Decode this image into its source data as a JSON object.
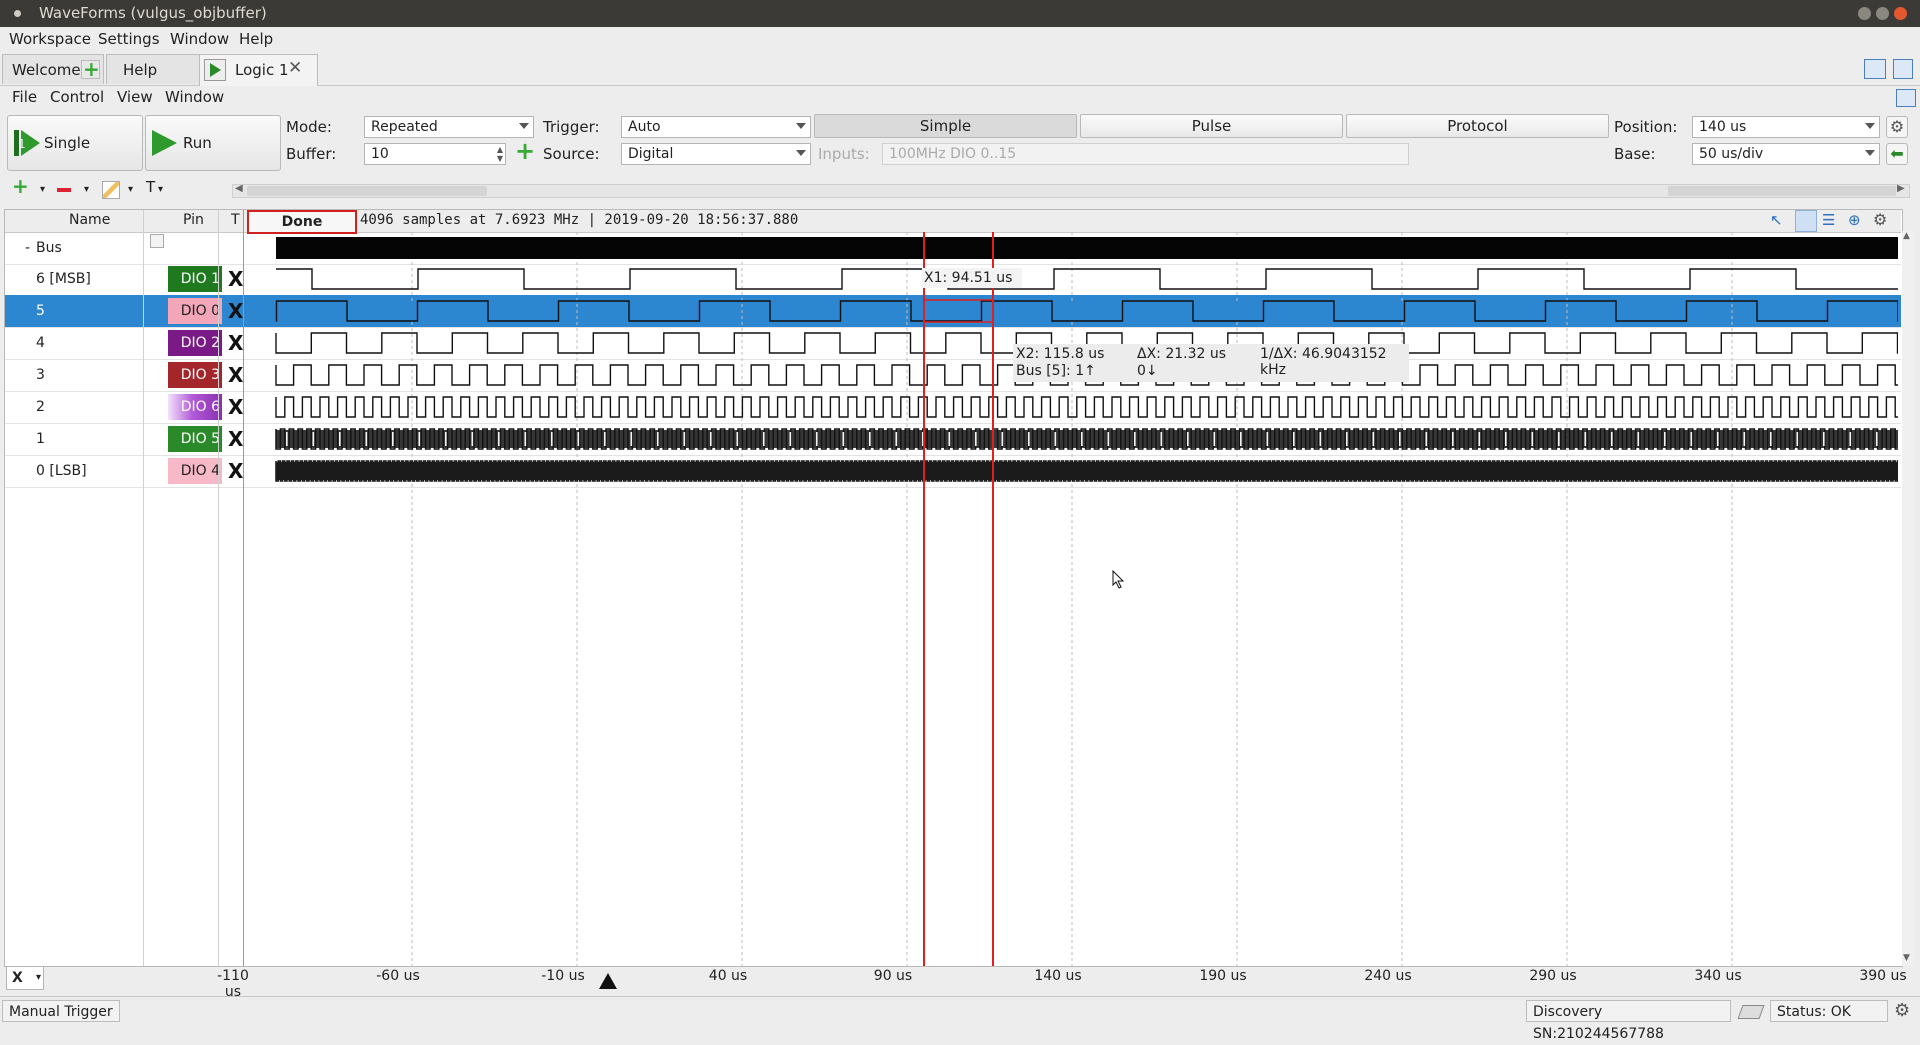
{
  "window": {
    "title": "WaveForms (vulgus_objbuffer)"
  },
  "menubar": {
    "items": [
      "Workspace",
      "Settings",
      "Window",
      "Help"
    ]
  },
  "tabs": [
    {
      "label": "Welcome"
    },
    {
      "label": "Help"
    },
    {
      "label": "Logic 1"
    }
  ],
  "submenu": {
    "items": [
      "File",
      "Control",
      "View",
      "Window"
    ]
  },
  "toolbar": {
    "single_label": "Single",
    "run_label": "Run",
    "mode_label": "Mode:",
    "mode_value": "Repeated",
    "buffer_label": "Buffer:",
    "buffer_value": "10",
    "trigger_label": "Trigger:",
    "trigger_value": "Auto",
    "source_label": "Source:",
    "source_value": "Digital",
    "trigger_tabs": [
      "Simple",
      "Pulse",
      "Protocol"
    ],
    "active_tab": "Simple",
    "inputs_label": "Inputs:",
    "inputs_value": "100MHz DIO 0..15",
    "position_label": "Position:",
    "position_value": "140 us",
    "base_label": "Base:",
    "base_value": "50 us/div"
  },
  "columns": {
    "name": "Name",
    "pin": "Pin",
    "t": "T"
  },
  "acquisition": {
    "state": "Done",
    "info": "4096 samples at 7.6923 MHz | 2019-09-20 18:56:37.880"
  },
  "channels": [
    {
      "name": "Bus",
      "pin": "",
      "toggle": "-"
    },
    {
      "name": "6 [MSB]",
      "pin": "DIO 1",
      "pin_color": "#1f7a1f",
      "trigger": "X"
    },
    {
      "name": "5",
      "pin": "DIO 0",
      "pin_color": "#f2a6b8",
      "trigger": "X"
    },
    {
      "name": "4",
      "pin": "DIO 2",
      "pin_color": "#7a1a86",
      "trigger": "X"
    },
    {
      "name": "3",
      "pin": "DIO 3",
      "pin_color": "#a3262b",
      "trigger": "X"
    },
    {
      "name": "2",
      "pin": "DIO 6",
      "pin_color": "#a54bd1",
      "trigger": "X"
    },
    {
      "name": "1",
      "pin": "DIO 5",
      "pin_color": "#2a8a2a",
      "trigger": "X"
    },
    {
      "name": "0 [LSB]",
      "pin": "DIO 4",
      "pin_color": "#f7b8c8",
      "trigger": "X"
    }
  ],
  "cursors": {
    "x1_label": "X1: 94.51 us",
    "x2_label": "X2: 115.8 us",
    "dx_label": "ΔX: 21.32 us",
    "inv_dx_label": "1/ΔX: 46.9043152 kHz",
    "bus_label": "Bus [5]:  1↑",
    "bus_value2": "0↓"
  },
  "time_axis": {
    "ticks": [
      "-110 us",
      "-60 us",
      "-10 us",
      "40 us",
      "90 us",
      "140 us",
      "190 us",
      "240 us",
      "290 us",
      "340 us",
      "390 us"
    ]
  },
  "statusbar": {
    "manual_trigger": "Manual Trigger",
    "device": "Discovery SN:210244567788",
    "status": "Status: OK"
  },
  "colors": {
    "selected_row": "#2d86d0",
    "cursor": "#e02020",
    "trace": "#111111"
  }
}
